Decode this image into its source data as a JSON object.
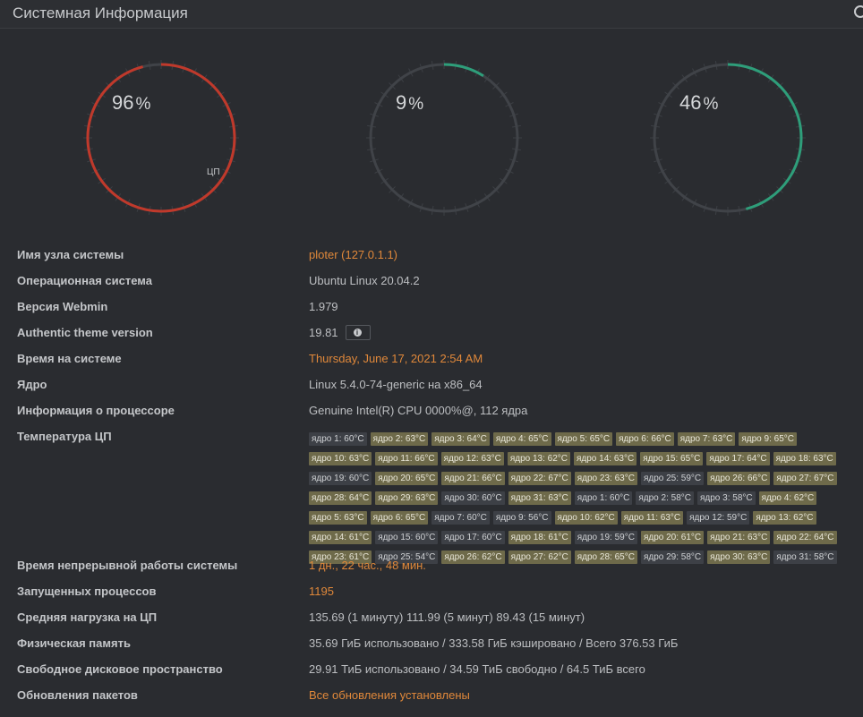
{
  "header": {
    "title": "Системная Информация"
  },
  "gauges": [
    {
      "name": "cpu",
      "value": 96,
      "pct_sign": "%",
      "label": "ЦП",
      "color": "#c0392b"
    },
    {
      "name": "memory",
      "value": 9,
      "pct_sign": "%",
      "label": "",
      "color": "#2e9e7a"
    },
    {
      "name": "disk",
      "value": 46,
      "pct_sign": "%",
      "label": "",
      "color": "#2e9e7a"
    }
  ],
  "info": {
    "hostname": {
      "label": "Имя узла системы",
      "value": "ploter (127.0.1.1)"
    },
    "os": {
      "label": "Операционная система",
      "value": "Ubuntu Linux 20.04.2"
    },
    "webmin": {
      "label": "Версия Webmin",
      "value": "1.979"
    },
    "theme": {
      "label": "Authentic theme version",
      "value": "19.81"
    },
    "time": {
      "label": "Время на системе",
      "value": "Thursday, June 17, 2021 2:54 AM"
    },
    "kernel": {
      "label": "Ядро",
      "value": "Linux 5.4.0-74-generic на x86_64"
    },
    "cpuinfo": {
      "label": "Информация о процессоре",
      "value": "Genuine Intel(R) CPU 0000%@, 112 ядра"
    },
    "cputemp": {
      "label": "Температура ЦП"
    },
    "uptime": {
      "label": "Время непрерывной работы системы",
      "value": "1 дн., 22 час., 48 мин."
    },
    "procs": {
      "label": "Запущенных процессов",
      "value": "1195"
    },
    "load": {
      "label": "Средняя нагрузка на ЦП",
      "value": "135.69 (1 минуту) 111.99 (5 минут) 89.43 (15 минут)"
    },
    "memory": {
      "label": "Физическая память",
      "value": "35.69 ГиБ использовано / 333.58 ГиБ кэшировано / Всего 376.53 ГиБ"
    },
    "disk": {
      "label": "Свободное дисковое пространство",
      "value": "29.91 ТиБ использовано / 34.59 ТиБ свободно / 64.5 ТиБ всего"
    },
    "updates": {
      "label": "Обновления пакетов",
      "value": "Все обновления установлены"
    }
  },
  "temperatures": [
    {
      "text": "ядро 1: 60°C",
      "hot": false
    },
    {
      "text": "ядро 2: 63°C",
      "hot": true
    },
    {
      "text": "ядро 3: 64°C",
      "hot": true
    },
    {
      "text": "ядро 4: 65°C",
      "hot": true
    },
    {
      "text": "ядро 5: 65°C",
      "hot": true
    },
    {
      "text": "ядро 6: 66°C",
      "hot": true
    },
    {
      "text": "ядро 7: 63°C",
      "hot": true
    },
    {
      "text": "ядро 9: 65°C",
      "hot": true
    },
    {
      "text": "ядро 10: 63°C",
      "hot": true
    },
    {
      "text": "ядро 11: 66°C",
      "hot": true
    },
    {
      "text": "ядро 12: 63°C",
      "hot": true
    },
    {
      "text": "ядро 13: 62°C",
      "hot": true
    },
    {
      "text": "ядро 14: 63°C",
      "hot": true
    },
    {
      "text": "ядро 15: 65°C",
      "hot": true
    },
    {
      "text": "ядро 17: 64°C",
      "hot": true
    },
    {
      "text": "ядро 18: 63°C",
      "hot": true
    },
    {
      "text": "ядро 19: 60°C",
      "hot": false
    },
    {
      "text": "ядро 20: 65°C",
      "hot": true
    },
    {
      "text": "ядро 21: 66°C",
      "hot": true
    },
    {
      "text": "ядро 22: 67°C",
      "hot": true
    },
    {
      "text": "ядро 23: 63°C",
      "hot": true
    },
    {
      "text": "ядро 25: 59°C",
      "hot": false
    },
    {
      "text": "ядро 26: 66°C",
      "hot": true
    },
    {
      "text": "ядро 27: 67°C",
      "hot": true
    },
    {
      "text": "ядро 28: 64°C",
      "hot": true
    },
    {
      "text": "ядро 29: 63°C",
      "hot": true
    },
    {
      "text": "ядро 30: 60°C",
      "hot": false
    },
    {
      "text": "ядро 31: 63°C",
      "hot": true
    },
    {
      "text": "ядро 1: 60°C",
      "hot": false
    },
    {
      "text": "ядро 2: 58°C",
      "hot": false
    },
    {
      "text": "ядро 3: 58°C",
      "hot": false
    },
    {
      "text": "ядро 4: 62°C",
      "hot": true
    },
    {
      "text": "ядро 5: 63°C",
      "hot": true
    },
    {
      "text": "ядро 6: 65°C",
      "hot": true
    },
    {
      "text": "ядро 7: 60°C",
      "hot": false
    },
    {
      "text": "ядро 9: 56°C",
      "hot": false
    },
    {
      "text": "ядро 10: 62°C",
      "hot": true
    },
    {
      "text": "ядро 11: 63°C",
      "hot": true
    },
    {
      "text": "ядро 12: 59°C",
      "hot": false
    },
    {
      "text": "ядро 13: 62°C",
      "hot": true
    },
    {
      "text": "ядро 14: 61°C",
      "hot": true
    },
    {
      "text": "ядро 15: 60°C",
      "hot": false
    },
    {
      "text": "ядро 17: 60°C",
      "hot": false
    },
    {
      "text": "ядро 18: 61°C",
      "hot": true
    },
    {
      "text": "ядро 19: 59°C",
      "hot": false
    },
    {
      "text": "ядро 20: 61°C",
      "hot": true
    },
    {
      "text": "ядро 21: 63°C",
      "hot": true
    },
    {
      "text": "ядро 22: 64°C",
      "hot": true
    },
    {
      "text": "ядро 23: 61°C",
      "hot": true
    },
    {
      "text": "ядро 25: 54°C",
      "hot": false
    },
    {
      "text": "ядро 26: 62°C",
      "hot": true
    },
    {
      "text": "ядро 27: 62°C",
      "hot": true
    },
    {
      "text": "ядро 28: 65°C",
      "hot": true
    },
    {
      "text": "ядро 29: 58°C",
      "hot": false
    },
    {
      "text": "ядро 30: 63°C",
      "hot": true
    },
    {
      "text": "ядро 31: 58°C",
      "hot": false
    }
  ]
}
